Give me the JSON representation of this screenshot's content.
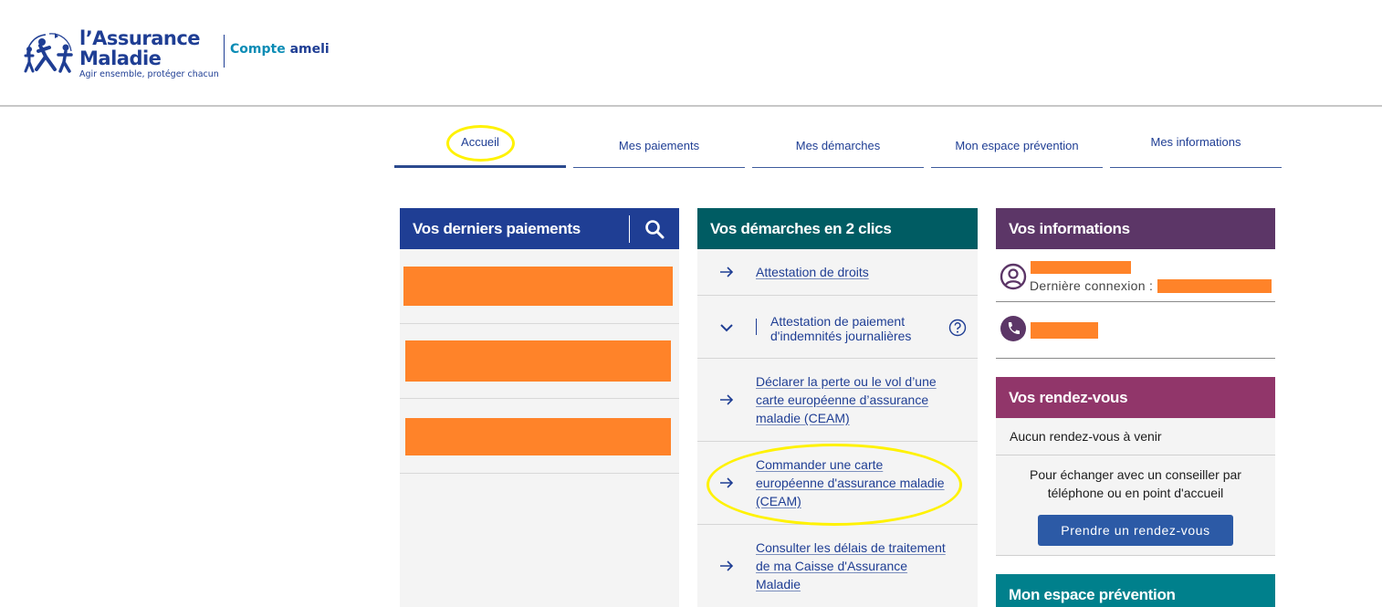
{
  "header": {
    "brand_line1": "l’Assurance",
    "brand_line2": "Maladie",
    "brand_tagline": "Agir ensemble, protéger chacun",
    "account_label_part1": "Compte",
    "account_label_part2": "ameli"
  },
  "nav": {
    "tabs": [
      {
        "label": "Accueil",
        "active": true
      },
      {
        "label": "Mes paiements",
        "active": false
      },
      {
        "label": "Mes démarches",
        "active": false
      },
      {
        "label": "Mon espace prévention",
        "active": false
      },
      {
        "label": "Mes informations",
        "active": false
      }
    ]
  },
  "payments": {
    "title": "Vos derniers paiements",
    "search_icon": "search-icon"
  },
  "demarches": {
    "title": "Vos démarches en 2 clics",
    "items": [
      {
        "label": "Attestation de droits"
      },
      {
        "label_line1": "Attestation de paiement",
        "label_line2": "d'indemnités journalières"
      },
      {
        "label_line1": "Déclarer la perte ou le vol d’une",
        "label_line2": "carte européenne d’assurance",
        "label_line3": "maladie (CEAM)"
      },
      {
        "label_line1": "Commander une carte",
        "label_line2": "européenne d'assurance maladie",
        "label_line3": "(CEAM)"
      },
      {
        "label_line1": "Consulter les délais de traitement",
        "label_line2": "de ma Caisse d'Assurance",
        "label_line3": "Maladie"
      }
    ]
  },
  "infos": {
    "title": "Vos informations",
    "last_login_label": "Dernière connexion :"
  },
  "rdv": {
    "title": "Vos rendez-vous",
    "none_text": "Aucun rendez-vous à venir",
    "exchange_line1": "Pour échanger avec un conseiller par",
    "exchange_line2": "téléphone ou en point d'accueil",
    "button_label": "Prendre un rendez-vous"
  },
  "prevention": {
    "title": "Mon espace prévention"
  },
  "colors": {
    "brand_blue": "#1f3e94",
    "teal": "#005c63",
    "purple": "#5c3667",
    "plum": "#91366a",
    "cyan": "#00808c",
    "redaction_orange": "#ff8329",
    "highlight_yellow": "#fff200"
  }
}
